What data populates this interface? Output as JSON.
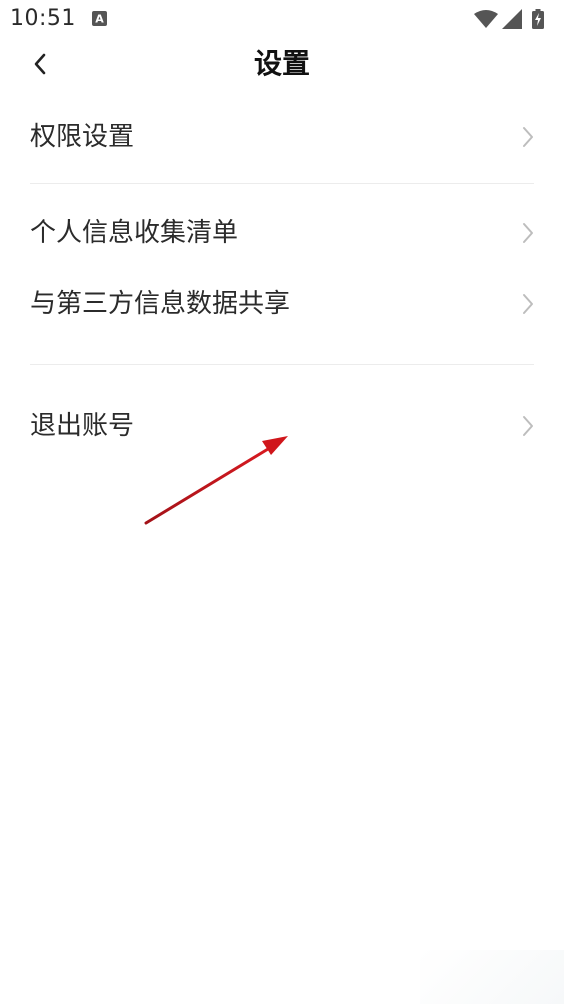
{
  "status_bar": {
    "time": "10:51",
    "left_icon": "a-notification-icon",
    "right_icons": [
      "wifi-icon",
      "signal-icon",
      "battery-charging-icon"
    ]
  },
  "header": {
    "back_icon": "chevron-left-icon",
    "title": "设置"
  },
  "menu": {
    "items": [
      {
        "label": "权限设置",
        "icon": "chevron-right-icon"
      },
      {
        "label": "个人信息收集清单",
        "icon": "chevron-right-icon"
      },
      {
        "label": "与第三方信息数据共享",
        "icon": "chevron-right-icon"
      },
      {
        "label": "退出账号",
        "icon": "chevron-right-icon"
      }
    ]
  },
  "annotation": {
    "type": "arrow",
    "color": "#d0161b",
    "points_to": "退出账号"
  }
}
